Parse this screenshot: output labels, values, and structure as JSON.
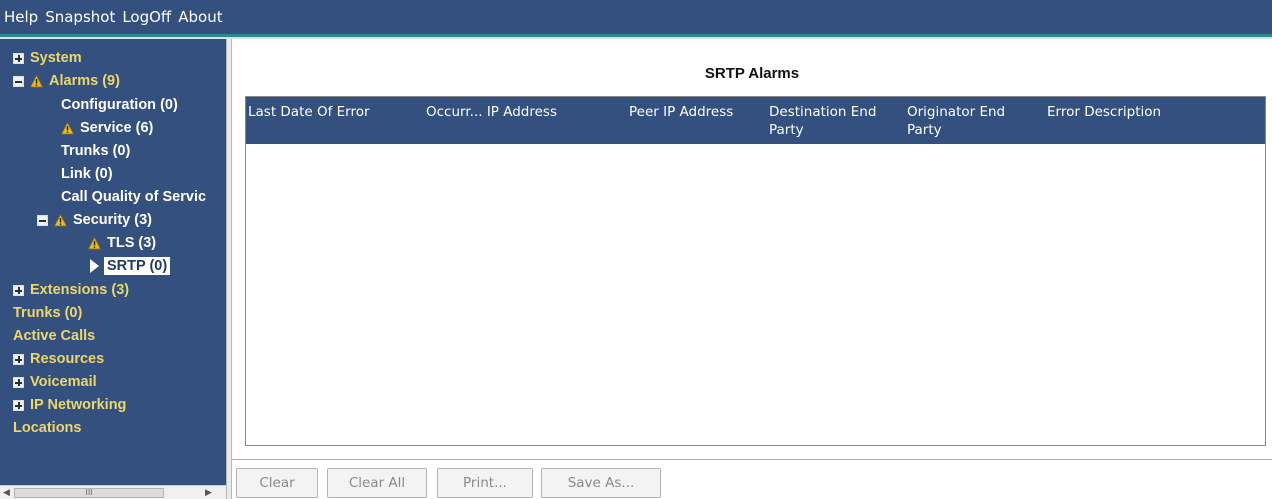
{
  "menu": {
    "items": [
      "Help",
      "Snapshot",
      "LogOff",
      "About"
    ]
  },
  "tree": {
    "system": "System",
    "alarms": "Alarms (9)",
    "configuration": "Configuration (0)",
    "service": "Service (6)",
    "trunks_alarm": "Trunks (0)",
    "link": "Link (0)",
    "call_quality": "Call Quality of Servic",
    "security": "Security (3)",
    "tls": "TLS (3)",
    "srtp": "SRTP (0)",
    "extensions": "Extensions (3)",
    "trunks": "Trunks (0)",
    "active_calls": "Active Calls",
    "resources": "Resources",
    "voicemail": "Voicemail",
    "ip_networking": "IP Networking",
    "locations": "Locations"
  },
  "scrollbar": {
    "thumb_grip": "III"
  },
  "main": {
    "title": "SRTP Alarms",
    "columns": [
      "Last Date Of Error",
      "Occurr... IP Address",
      "Peer IP Address",
      "Destination End Party",
      "Originator End Party",
      "Error Description"
    ],
    "rows": []
  },
  "buttons": {
    "clear": "Clear",
    "clear_all": "Clear All",
    "print": "Print...",
    "save_as": "Save As..."
  },
  "colors": {
    "navy": "#33507e",
    "tree_yellow": "#ecd76a",
    "warning": "#e8b923"
  }
}
